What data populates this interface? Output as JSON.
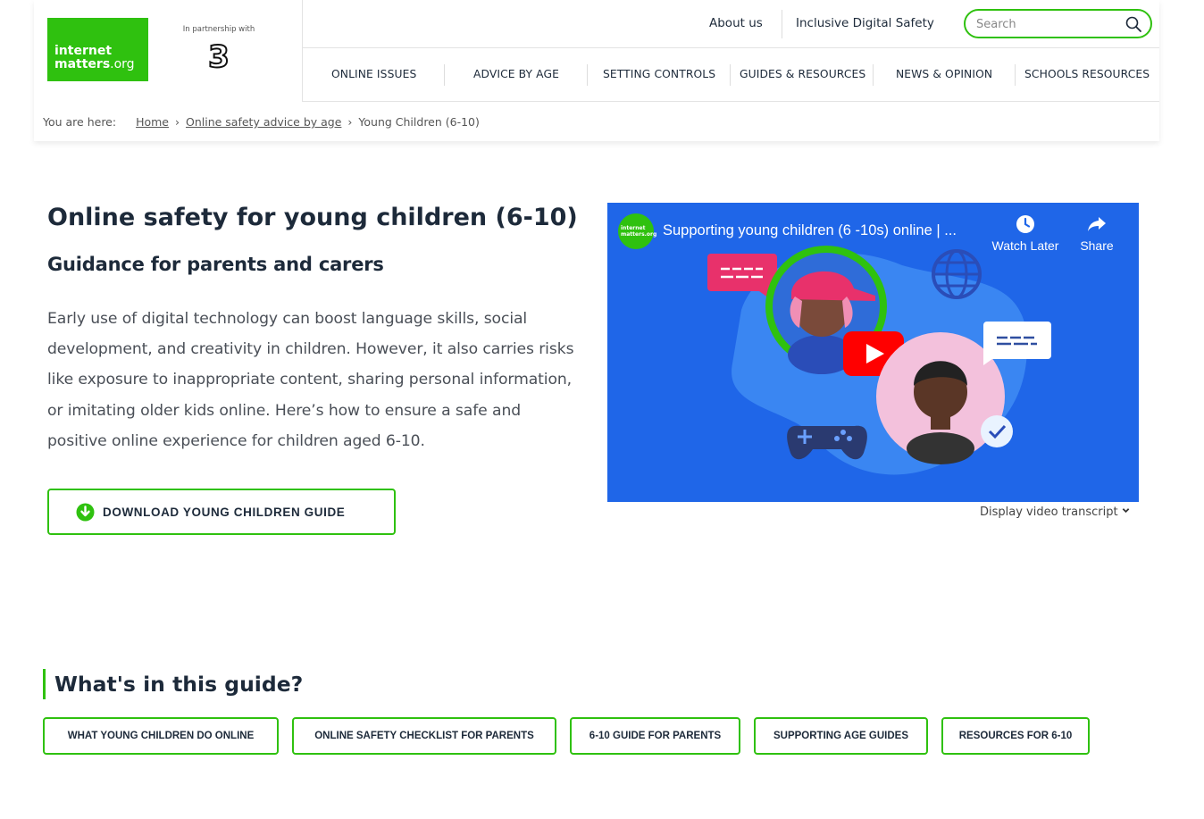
{
  "logo": {
    "line1": "internet",
    "line2": "matters",
    "line2_suffix": ".org"
  },
  "partner": {
    "text": "In partnership with",
    "brand": "3"
  },
  "topnav": {
    "about": "About us",
    "inclusive": "Inclusive Digital Safety"
  },
  "search": {
    "placeholder": "Search",
    "value": ""
  },
  "mainnav": {
    "items": [
      {
        "label": "ONLINE ISSUES"
      },
      {
        "label": "ADVICE BY AGE"
      },
      {
        "label": "SETTING CONTROLS"
      },
      {
        "label": "GUIDES & RESOURCES"
      },
      {
        "label": "NEWS & OPINION"
      },
      {
        "label": "SCHOOLS RESOURCES"
      }
    ]
  },
  "breadcrumb": {
    "prefix": "You are here:",
    "items": [
      {
        "label": "Home"
      },
      {
        "label": "Online safety advice by age"
      },
      {
        "label": "Young Children (6-10)"
      }
    ],
    "separator": "›"
  },
  "main": {
    "title": "Online safety for young children (6-10)",
    "subtitle": "Guidance for parents and carers",
    "intro": "Early use of digital technology can boost language skills, social development, and creativity in children. However, it also carries risks like exposure to inappropriate content, sharing personal information, or imitating older kids online. Here’s how to ensure a safe and positive online experience for children aged 6-10.",
    "download_label": "DOWNLOAD YOUNG CHILDREN GUIDE"
  },
  "video": {
    "title": "Supporting young children (6 -10s) online | ...",
    "channel_logo_line1": "internet",
    "channel_logo_line2": "matters.org",
    "watch_later": "Watch Later",
    "share": "Share",
    "transcript_label": "Display video transcript"
  },
  "guide": {
    "heading": "What's in this guide?",
    "buttons": [
      {
        "label": "WHAT YOUNG CHILDREN DO ONLINE"
      },
      {
        "label": "ONLINE SAFETY CHECKLIST FOR PARENTS"
      },
      {
        "label": "6-10 GUIDE FOR PARENTS"
      },
      {
        "label": "SUPPORTING AGE GUIDES"
      },
      {
        "label": "RESOURCES FOR 6-10"
      }
    ]
  },
  "colors": {
    "brand_green": "#2fc10f",
    "text_dark": "#1d2a3a",
    "video_bg": "#1f66e8",
    "youtube_red": "#ff0000"
  }
}
